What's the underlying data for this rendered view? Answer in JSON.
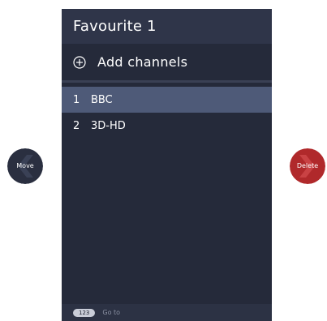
{
  "panel": {
    "title": "Favourite 1",
    "add_label": "Add channels",
    "channels": [
      {
        "number": "1",
        "name": "BBC",
        "selected": true
      },
      {
        "number": "2",
        "name": "3D-HD",
        "selected": false
      }
    ]
  },
  "footer": {
    "key": "123",
    "label": "Go to"
  },
  "actions": {
    "move_label": "Move",
    "delete_label": "Delete"
  },
  "colors": {
    "panel_bg": "#252a3a",
    "selected_row": "#4e5a78",
    "move_button": "#2a2f40",
    "delete_button": "#b0292b"
  },
  "icons": [
    "add-circle-icon",
    "chevron-left-icon",
    "chevron-right-icon"
  ]
}
